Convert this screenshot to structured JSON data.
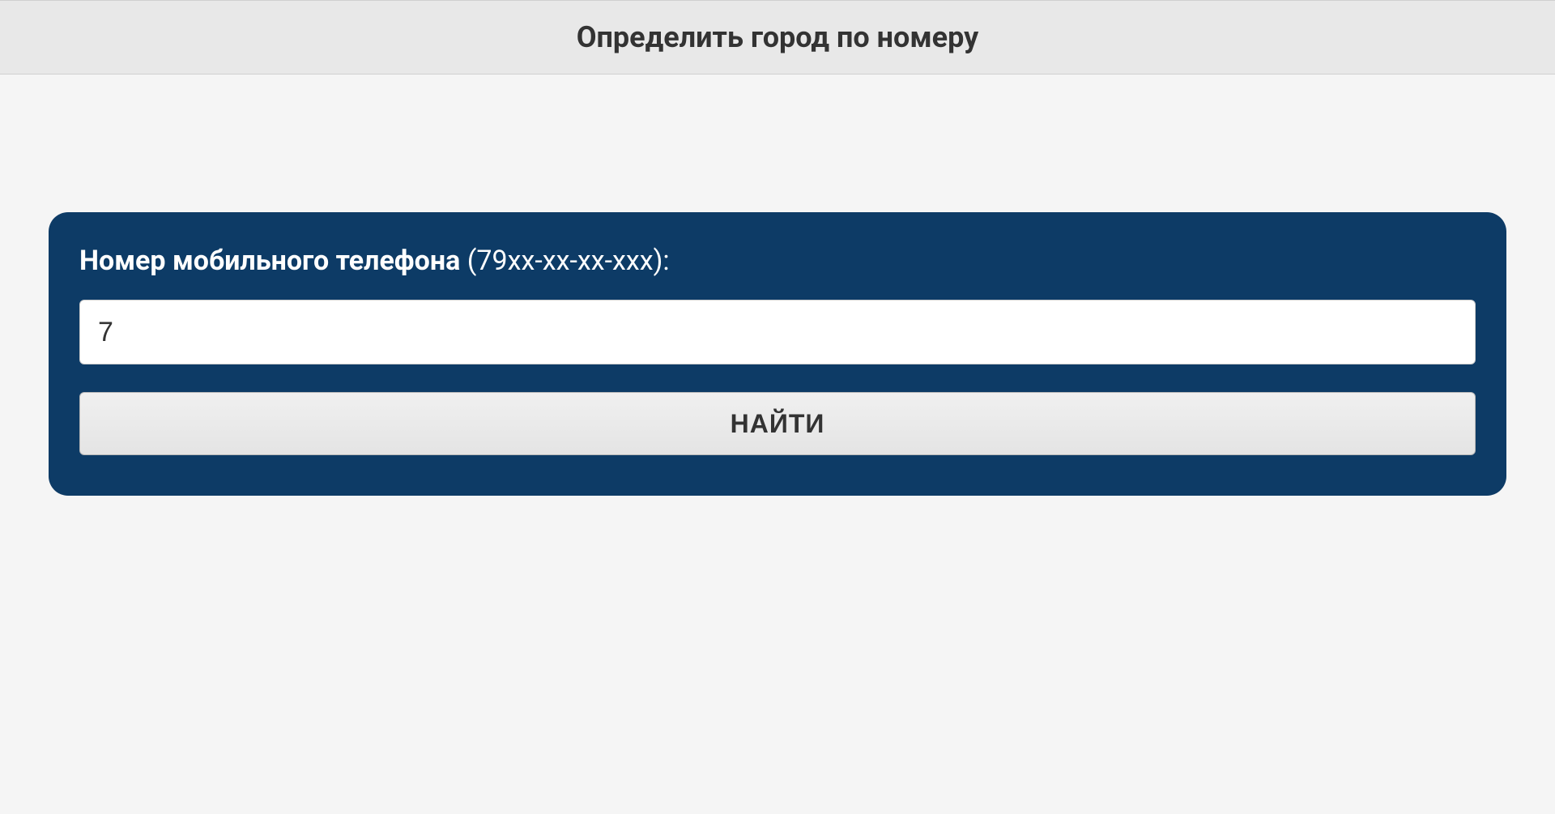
{
  "header": {
    "title": "Определить город по номеру"
  },
  "form": {
    "label_bold": "Номер мобильного телефона",
    "label_format": " (79xx-xx-xx-xxx):",
    "input_value": "7",
    "button_label": "НАЙТИ"
  }
}
